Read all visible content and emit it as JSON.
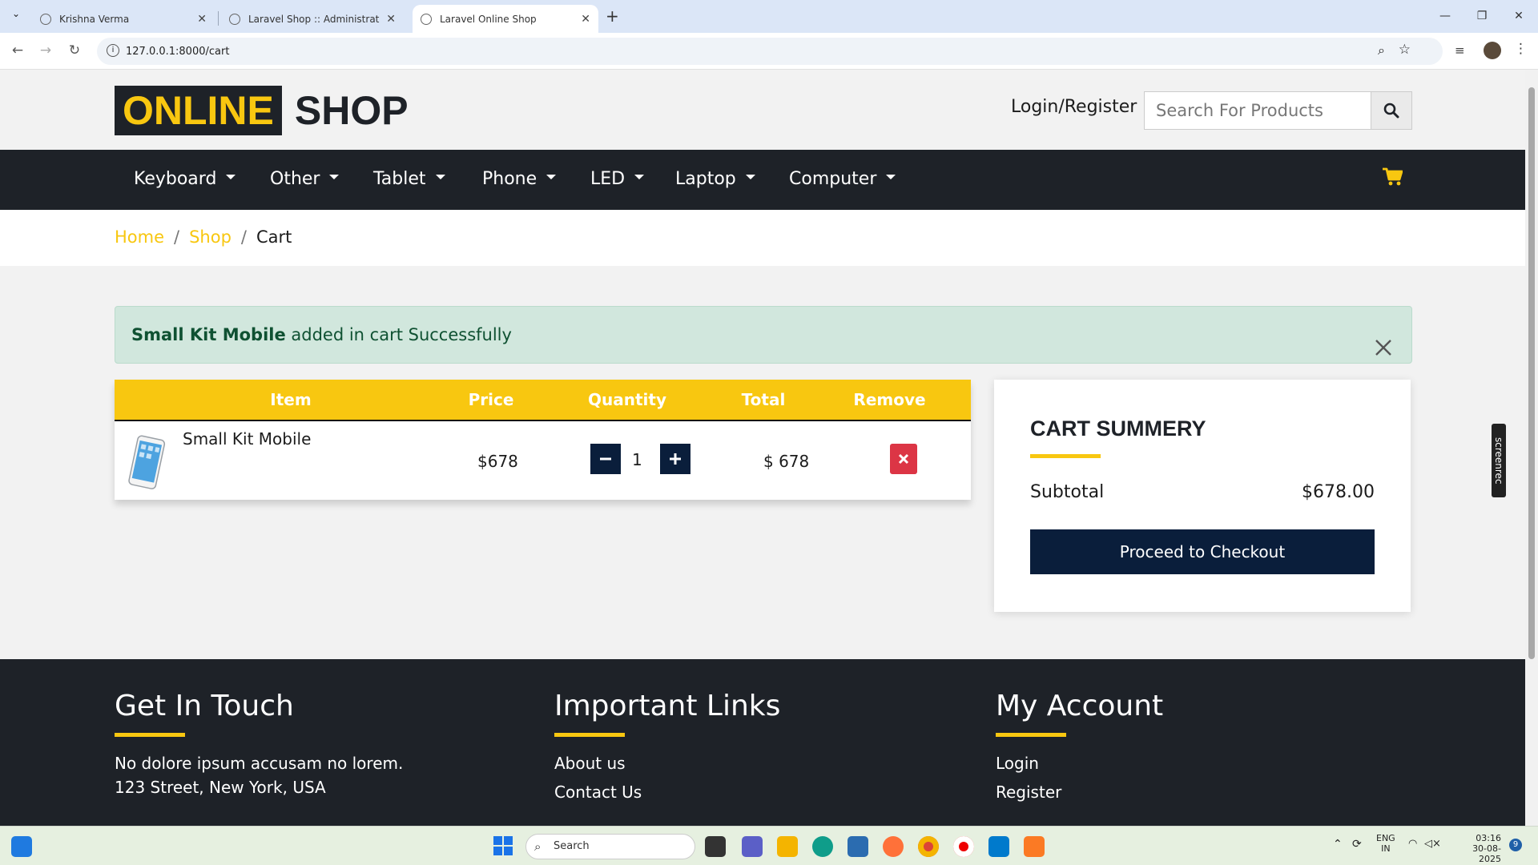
{
  "browser": {
    "tabs": [
      {
        "title": "Krishna Verma",
        "active": false
      },
      {
        "title": "Laravel Shop :: Administrative Panel",
        "active": false
      },
      {
        "title": "Laravel Online Shop",
        "active": true
      }
    ],
    "url": "127.0.0.1:8000/cart"
  },
  "header": {
    "logo_highlight": "ONLINE",
    "logo_rest": "SHOP",
    "login_label": "Login/Register",
    "search_placeholder": "Search For Products"
  },
  "nav": {
    "items": [
      "Keyboard",
      "Other",
      "Tablet",
      "Phone",
      "LED",
      "Laptop",
      "Computer"
    ]
  },
  "breadcrumb": {
    "home": "Home",
    "shop": "Shop",
    "current": "Cart",
    "separator": "/"
  },
  "alert": {
    "product": "Small Kit Mobile",
    "message": " added in cart Successfully"
  },
  "cart_table": {
    "headers": [
      "Item",
      "Price",
      "Quantity",
      "Total",
      "Remove"
    ],
    "rows": [
      {
        "name": "Small Kit Mobile",
        "price": "$678",
        "quantity": "1",
        "total": "$ 678"
      }
    ]
  },
  "summary": {
    "title": "CART SUMMERY",
    "subtotal_label": "Subtotal",
    "subtotal_value": "$678.00",
    "checkout_label": "Proceed to Checkout"
  },
  "footer": {
    "touch_title": "Get In Touch",
    "touch_lines": [
      "No dolore ipsum accusam no lorem.",
      "123 Street, New York, USA"
    ],
    "links_title": "Important Links",
    "links": [
      "About us",
      "Contact Us"
    ],
    "account_title": "My Account",
    "account_links": [
      "Login",
      "Register"
    ]
  },
  "extension_badge": "screenrec",
  "taskbar": {
    "search_placeholder": "Search",
    "lang_top": "ENG",
    "lang_bottom": "IN",
    "time": "03:16",
    "date": "30-08-2025",
    "notification_count": "9"
  },
  "colors": {
    "brand_yellow": "#f8c710",
    "dark": "#1e2228",
    "navy": "#0a1e3b",
    "danger": "#dc3545",
    "alert_bg": "#d1e7dd"
  }
}
